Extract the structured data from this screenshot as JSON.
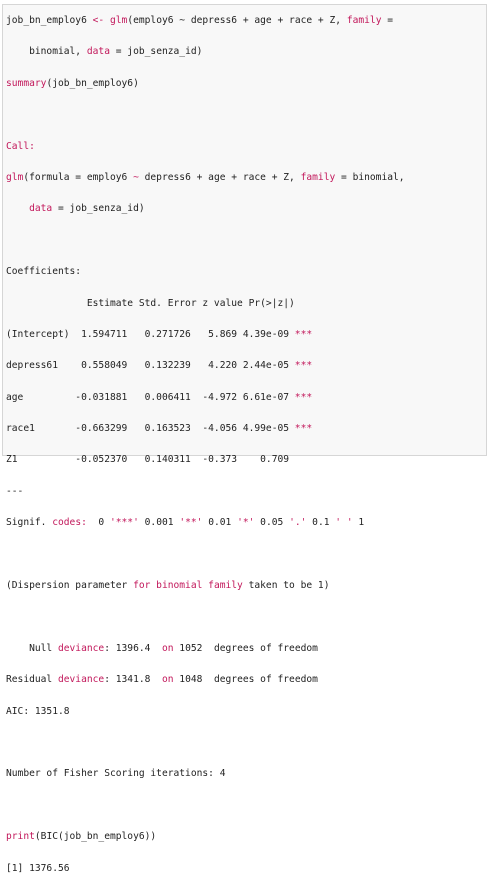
{
  "colors": {
    "accent": "#c2185b",
    "text": "#222222",
    "panel_bg": "#f8f8f8",
    "border": "#d6d6d6"
  },
  "lines": {
    "l1": {
      "a": "job_bn_employ6 ",
      "op": "<-",
      "b": " ",
      "fn": "glm",
      "c": "(employ6 ~ depress6 + age + race + Z, ",
      "arg": "family",
      "d": " ="
    },
    "l2": {
      "a": "    binomial, ",
      "arg": "data",
      "b": " = job_senza_id)"
    },
    "l3": {
      "fn": "summary",
      "a": "(job_bn_employ6)"
    },
    "l5": {
      "a": "Call:"
    },
    "l6": {
      "fn": "glm",
      "a": "(formula = employ6 ",
      "op": "~",
      "b": " depress6 + age + race + Z, ",
      "arg": "family",
      "c": " = binomial,"
    },
    "l7": {
      "a": "    ",
      "arg": "data",
      "b": " = job_senza_id)"
    },
    "l9": {
      "a": "Coefficients:"
    },
    "coef_header": "              Estimate Std. Error z value Pr(>|z|)",
    "coef_rows": [
      {
        "text": "(Intercept)  1.594711   0.271726   5.869 4.39e-09 ",
        "stars": "***"
      },
      {
        "text": "depress61    0.558049   0.132239   4.220 2.44e-05 ",
        "stars": "***"
      },
      {
        "text": "age         -0.031881   0.006411  -4.972 6.61e-07 ",
        "stars": "***"
      },
      {
        "text": "race1       -0.663299   0.163523  -4.056 4.99e-05 ",
        "stars": "***"
      },
      {
        "text": "Z1          -0.052370   0.140311  -0.373    0.709",
        "stars": ""
      }
    ],
    "dashes": "---",
    "signif": {
      "a": "Signif. ",
      "codes": "codes:",
      "b": "  0 ",
      "s1": "'***'",
      "c": " 0.001 ",
      "s2": "'**'",
      "d": " 0.01 ",
      "s3": "'*'",
      "e": " 0.05 ",
      "s4": "'.'",
      "f": " 0.1 ",
      "s5": "' '",
      "g": " 1"
    },
    "dispersion": {
      "a": "(Dispersion parameter ",
      "b": "for",
      "c": " binomial ",
      "d": "family",
      "e": " taken to be 1)"
    },
    "null_dev": {
      "a": "    Null ",
      "b": "deviance",
      "c": ": 1396.4  ",
      "d": "on",
      "e": " 1052  degrees of freedom"
    },
    "resid_dev": {
      "a": "Residual ",
      "b": "deviance",
      "c": ": 1341.8  ",
      "d": "on",
      "e": " 1048  degrees of freedom"
    },
    "aic": "AIC: 1351.8",
    "fisher": "Number of Fisher Scoring iterations: 4",
    "print_bic": {
      "fn": "print",
      "a": "(",
      "fn2": "BIC",
      "b": "(job_bn_employ6))"
    },
    "result": "[1] 1376.56"
  }
}
